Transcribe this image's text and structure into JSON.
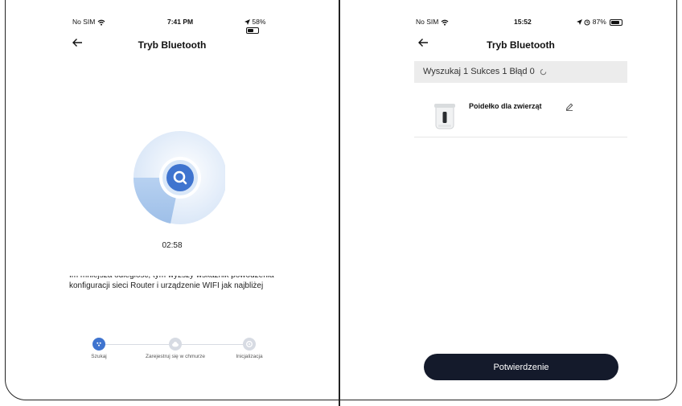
{
  "left": {
    "status": {
      "carrier": "No SIM",
      "time": "7:41 PM",
      "battery": "58%",
      "battery_fill": 0.58
    },
    "title": "Tryb Bluetooth",
    "timer": "02:58",
    "tip_text": "Im mniejsza odległość, tym wyższy wskaźnik powodzenia konfiguracji sieci Router i urządzenie WIFI jak najbliżej",
    "steps": [
      {
        "label": "Szukaj",
        "active": true
      },
      {
        "label": "Zarejestruj się w chmurze",
        "active": false
      },
      {
        "label": "Inicjalizacja",
        "active": false
      }
    ],
    "colors": {
      "accent": "#3f74cf",
      "ring": "#bfd6f3",
      "inactive": "#d7dbe3"
    }
  },
  "right": {
    "status": {
      "carrier": "No SIM",
      "time": "15:52",
      "battery": "87%",
      "battery_fill": 0.87
    },
    "title": "Tryb Bluetooth",
    "summary": "Wyszukaj 1 Sukces 1 Błąd 0",
    "device": {
      "name": "Poidełko dla zwierząt"
    },
    "confirm_label": "Potwierdzenie",
    "colors": {
      "button": "#141a2b"
    }
  }
}
